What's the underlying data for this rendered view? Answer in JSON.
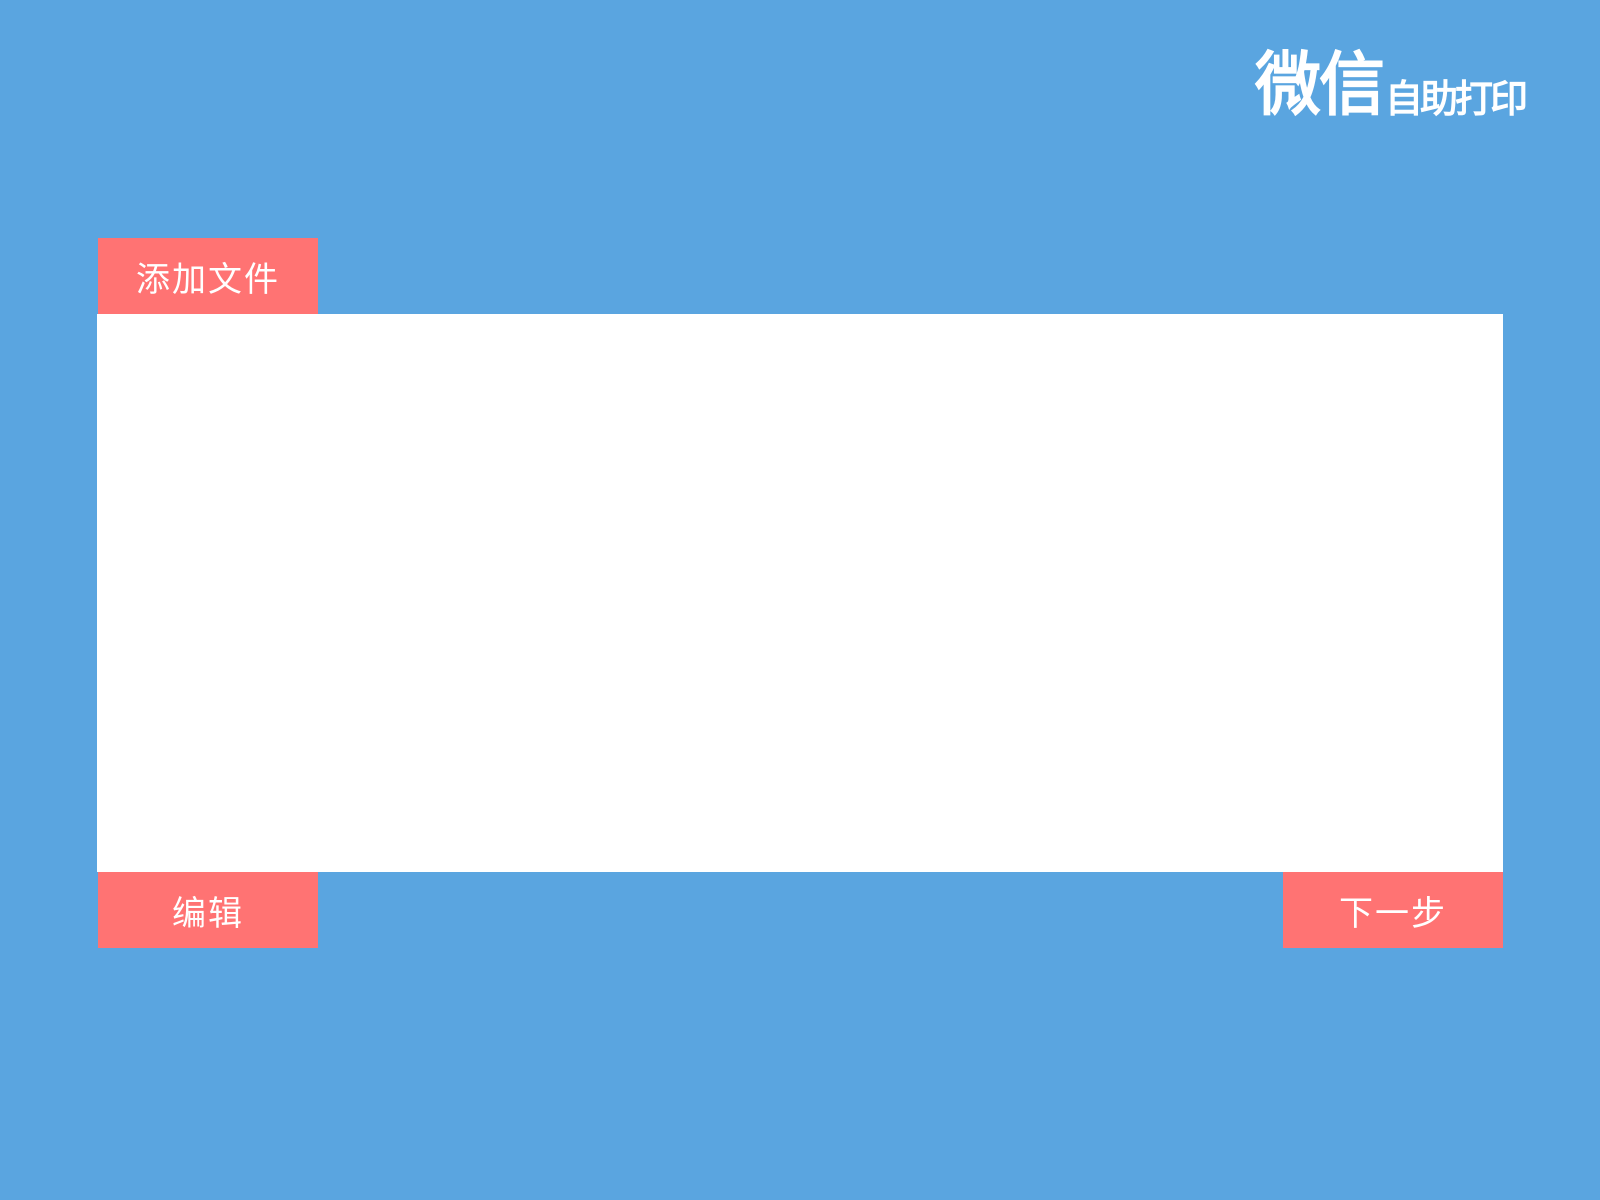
{
  "logo": {
    "main": "微信",
    "sub": "自助打印"
  },
  "toolbar": {
    "add_file_label": "添加文件",
    "edit_label": "编辑",
    "next_label": "下一步"
  },
  "colors": {
    "background": "#5aa5e0",
    "button": "#ff7373",
    "panel": "#ffffff"
  }
}
